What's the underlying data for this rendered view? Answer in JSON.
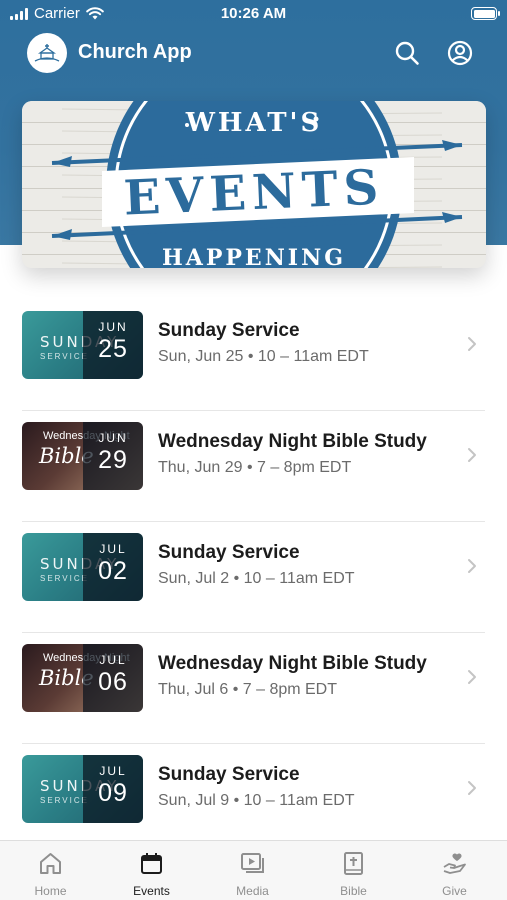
{
  "status_bar": {
    "carrier": "Carrier",
    "time": "10:26 AM"
  },
  "header": {
    "title": "Church App"
  },
  "banner": {
    "line1": "WHAT'S",
    "line2": "EVENTS",
    "line3": "HAPPENING"
  },
  "events": [
    {
      "title": "Sunday Service",
      "meta": "Sun, Jun 25 • 10 – 11am EDT",
      "month": "JUN",
      "day": "25",
      "thumb": "sunday",
      "thumb_text": "SUNDAY",
      "thumb_sub": "SERVICE"
    },
    {
      "title": "Wednesday Night Bible Study",
      "meta": "Thu, Jun 29 • 7 – 8pm EDT",
      "month": "JUN",
      "day": "29",
      "thumb": "bible",
      "thumb_top": "Wednesday Night",
      "thumb_text": "Bible"
    },
    {
      "title": "Sunday Service",
      "meta": "Sun, Jul 2 • 10 – 11am EDT",
      "month": "JUL",
      "day": "02",
      "thumb": "sunday",
      "thumb_text": "SUNDAY",
      "thumb_sub": "SERVICE"
    },
    {
      "title": "Wednesday Night Bible Study",
      "meta": "Thu, Jul 6 • 7 – 8pm EDT",
      "month": "JUL",
      "day": "06",
      "thumb": "bible",
      "thumb_top": "Wednesday Night",
      "thumb_text": "Bible"
    },
    {
      "title": "Sunday Service",
      "meta": "Sun, Jul 9 • 10 – 11am EDT",
      "month": "JUL",
      "day": "09",
      "thumb": "sunday",
      "thumb_text": "SUNDAY",
      "thumb_sub": "SERVICE"
    }
  ],
  "tabs": [
    {
      "label": "Home",
      "icon": "home-icon",
      "active": false
    },
    {
      "label": "Events",
      "icon": "calendar-icon",
      "active": true
    },
    {
      "label": "Media",
      "icon": "media-icon",
      "active": false
    },
    {
      "label": "Bible",
      "icon": "bible-icon",
      "active": false
    },
    {
      "label": "Give",
      "icon": "give-icon",
      "active": false
    }
  ],
  "colors": {
    "header": "#2e6f9e",
    "banner_blue": "#2c6b9c",
    "active_tab": "#1c1c1c",
    "inactive_tab": "#8f8f8f"
  }
}
